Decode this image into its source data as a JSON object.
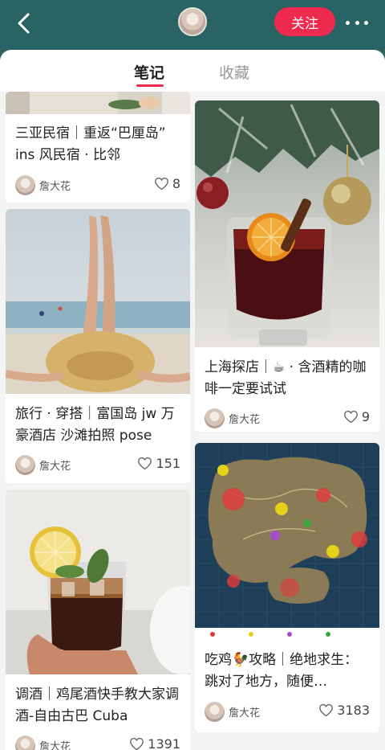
{
  "header": {
    "follow_label": "关注"
  },
  "tabs": [
    {
      "label": "笔记",
      "active": true
    },
    {
      "label": "收藏",
      "active": false
    }
  ],
  "colors": {
    "header_bg": "#2a6363",
    "accent": "#ee2a4e",
    "page_bg": "#f4f4f4"
  },
  "notes": [
    {
      "title": "三亚民宿｜重返“巴厘岛” ins 风民宿 · 比邻",
      "author": "詹大花",
      "likes": "8"
    },
    {
      "title": "上海探店｜☕ · 含酒精的咖啡一定要试试",
      "author": "詹大花",
      "likes": "9"
    },
    {
      "title": "旅行 · 穿搭｜富国岛 jw 万豪酒店 沙滩拍照 pose",
      "author": "詹大花",
      "likes": "151"
    },
    {
      "title": "吃鸡🐓攻略｜绝地求生：跳对了地方，随便…",
      "author": "詹大花",
      "likes": "3183"
    },
    {
      "title": "调酒｜鸡尾酒快手教大家调酒-自由古巴 Cuba",
      "author": "詹大花",
      "likes": "1391"
    }
  ]
}
